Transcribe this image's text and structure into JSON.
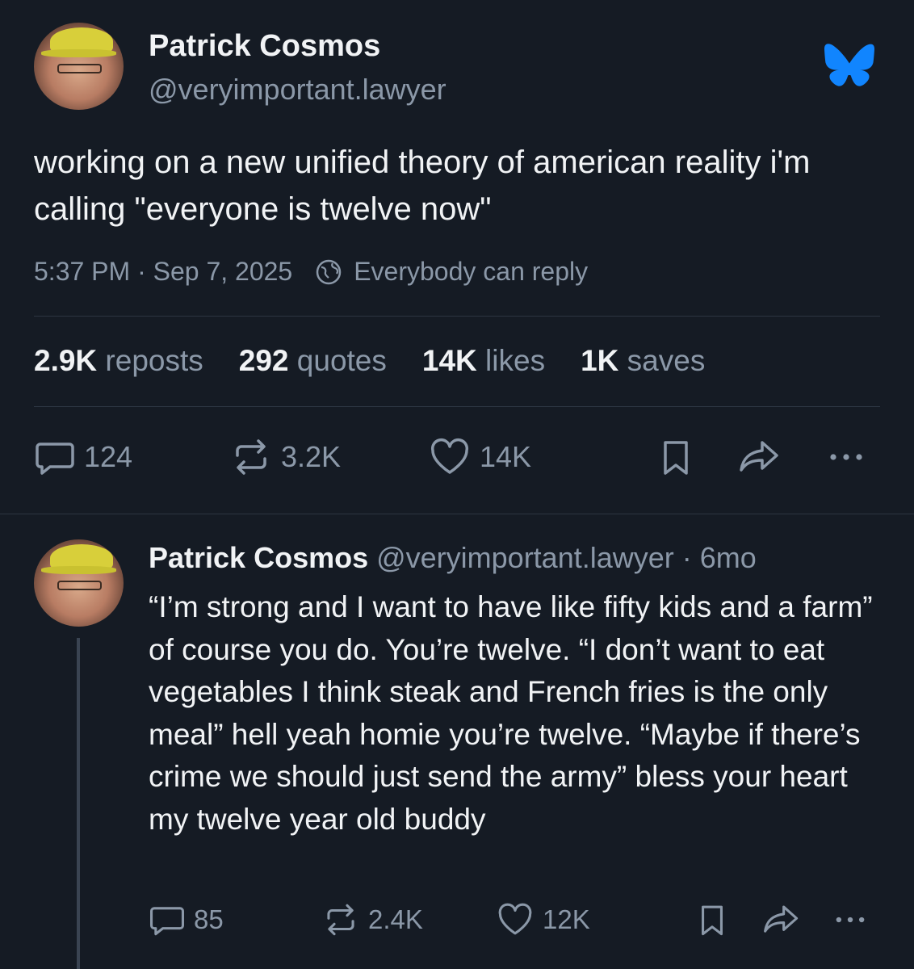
{
  "post": {
    "author_name": "Patrick Cosmos",
    "author_handle": "@veryimportant.lawyer",
    "text": "working on a new unified theory of american reality i'm calling \"everyone is twelve now\"",
    "time": "5:37 PM · Sep 7, 2025",
    "reply_setting": "Everybody can reply",
    "stats": [
      {
        "value": "2.9K",
        "label": " reposts"
      },
      {
        "value": "292",
        "label": " quotes"
      },
      {
        "value": "14K",
        "label": " likes"
      },
      {
        "value": "1K",
        "label": " saves"
      }
    ],
    "actions": {
      "replies": "124",
      "reposts": "3.2K",
      "likes": "14K"
    },
    "brand_icon": "butterfly-icon",
    "brand_color": "#1185fe"
  },
  "reply": {
    "author_name": "Patrick Cosmos",
    "author_handle": " @veryimportant.lawyer",
    "age": " · 6mo",
    "text": "“I’m strong and I want to have like fifty kids and a farm” of course you do. You’re twelve. “I don’t want to eat vegetables I think steak and French fries is the only meal” hell yeah homie you’re twelve. “Maybe if there’s crime we should just send the army” bless your heart my twelve year old buddy",
    "actions": {
      "replies": "85",
      "reposts": "2.4K",
      "likes": "12K"
    }
  },
  "theme": {
    "background": "#151b24",
    "text": "#f1f3f5",
    "muted": "#8b98a8"
  }
}
